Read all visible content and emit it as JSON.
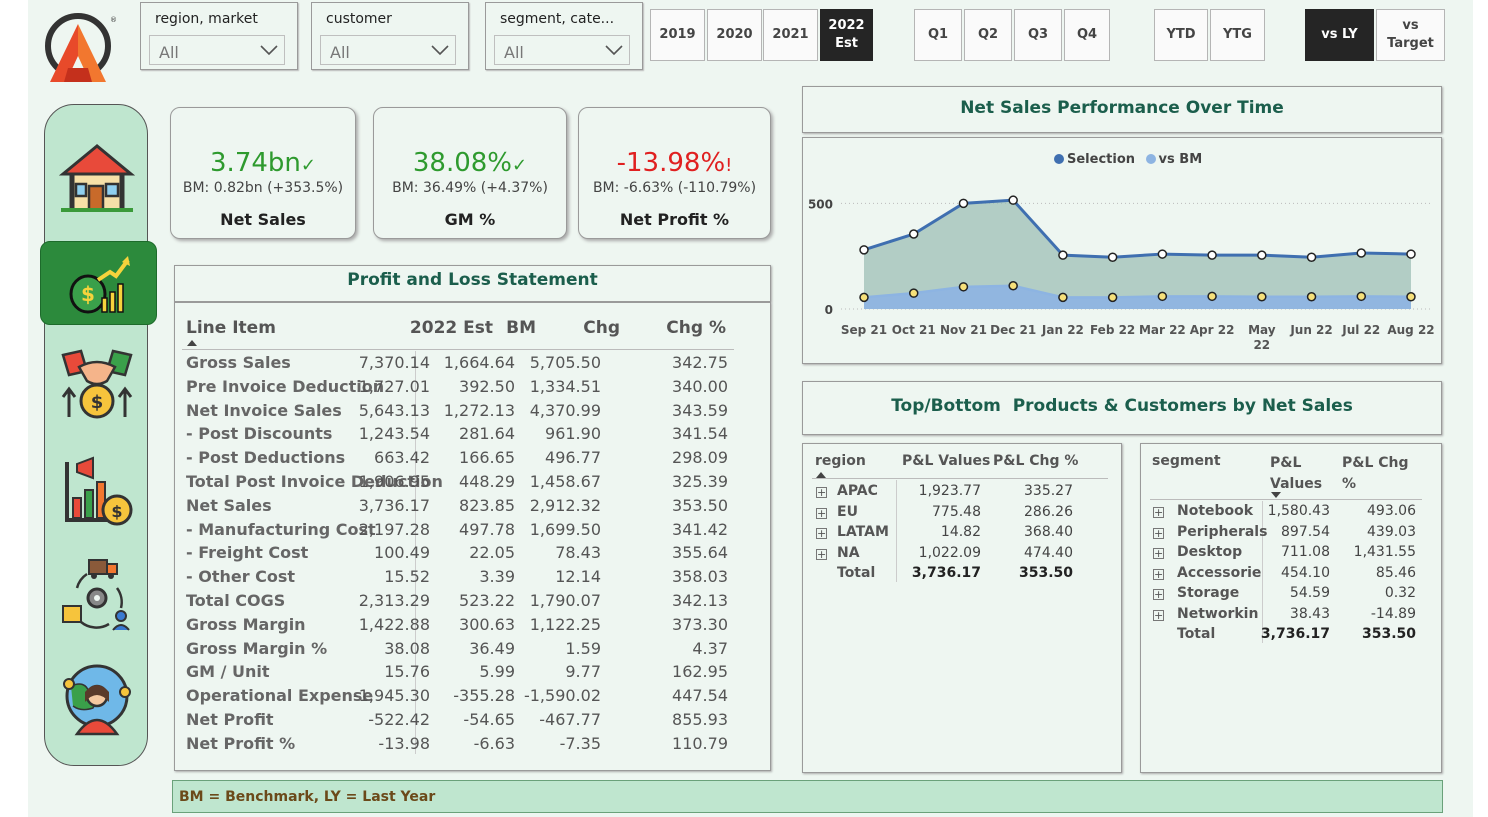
{
  "filters": [
    {
      "label": "region, market",
      "value": "All"
    },
    {
      "label": "customer",
      "value": "All"
    },
    {
      "label": "segment, cate...",
      "value": "All"
    }
  ],
  "years": [
    "2019",
    "2020",
    "2021",
    "2022 Est"
  ],
  "quarters": [
    "Q1",
    "Q2",
    "Q3",
    "Q4"
  ],
  "period": [
    "YTD",
    "YTG"
  ],
  "compare": [
    "vs LY",
    "vs Target"
  ],
  "kpis": [
    {
      "value": "3.74bn",
      "mark": "✓",
      "bm": "BM: 0.82bn (+353.5%)",
      "title": "Net Sales",
      "color": "#2e9a2e"
    },
    {
      "value": "38.08%",
      "mark": "✓",
      "bm": "BM: 36.49% (+4.37%)",
      "title": "GM %",
      "color": "#2e9a2e"
    },
    {
      "value": "-13.98%",
      "mark": "!",
      "bm": "BM: -6.63% (-110.79%)",
      "title": "Net Profit %",
      "color": "#e02020"
    }
  ],
  "pl": {
    "title": "Profit and Loss Statement",
    "headers": [
      "Line Item",
      "2022 Est",
      "BM",
      "Chg",
      "Chg %"
    ],
    "rows": [
      [
        "Gross Sales",
        "7,370.14",
        "1,664.64",
        "5,705.50",
        "342.75"
      ],
      [
        "Pre Invoice Deduction",
        "1,727.01",
        "392.50",
        "1,334.51",
        "340.00"
      ],
      [
        "Net Invoice Sales",
        "5,643.13",
        "1,272.13",
        "4,370.99",
        "343.59"
      ],
      [
        "- Post Discounts",
        "1,243.54",
        "281.64",
        "961.90",
        "341.54"
      ],
      [
        "- Post Deductions",
        "663.42",
        "166.65",
        "496.77",
        "298.09"
      ],
      [
        "Total Post Invoice Deduction",
        "1,906.95",
        "448.29",
        "1,458.67",
        "325.39"
      ],
      [
        "Net Sales",
        "3,736.17",
        "823.85",
        "2,912.32",
        "353.50"
      ],
      [
        "- Manufacturing Cost",
        "2,197.28",
        "497.78",
        "1,699.50",
        "341.42"
      ],
      [
        "- Freight Cost",
        "100.49",
        "22.05",
        "78.43",
        "355.64"
      ],
      [
        "- Other Cost",
        "15.52",
        "3.39",
        "12.14",
        "358.03"
      ],
      [
        "Total COGS",
        "2,313.29",
        "523.22",
        "1,790.07",
        "342.13"
      ],
      [
        "Gross Margin",
        "1,422.88",
        "300.63",
        "1,122.25",
        "373.30"
      ],
      [
        "Gross Margin %",
        "38.08",
        "36.49",
        "1.59",
        "4.37"
      ],
      [
        "GM / Unit",
        "15.76",
        "5.99",
        "9.77",
        "162.95"
      ],
      [
        "Operational Expense",
        "-1,945.30",
        "-355.28",
        "-1,590.02",
        "447.54"
      ],
      [
        "Net Profit",
        "-522.42",
        "-54.65",
        "-467.77",
        "855.93"
      ],
      [
        "Net Profit %",
        "-13.98",
        "-6.63",
        "-7.35",
        "110.79"
      ]
    ]
  },
  "line_chart": {
    "title": "Net Sales Performance Over Time",
    "legend": [
      "Selection",
      "vs BM"
    ]
  },
  "chart_data": {
    "type": "area",
    "categories": [
      "Sep 21",
      "Oct 21",
      "Nov 21",
      "Dec 21",
      "Jan 22",
      "Feb 22",
      "Mar 22",
      "Apr 22",
      "May 22",
      "Jun 22",
      "Jul 22",
      "Aug 22"
    ],
    "series": [
      {
        "name": "Selection",
        "values": [
          280,
          355,
          500,
          515,
          255,
          245,
          260,
          255,
          255,
          245,
          265,
          260
        ],
        "color": "#3f6fb0"
      },
      {
        "name": "vs BM",
        "values": [
          55,
          75,
          105,
          110,
          55,
          55,
          60,
          60,
          58,
          58,
          60,
          58
        ],
        "color": "#8db4e2"
      }
    ],
    "yticks": [
      0,
      500
    ],
    "ylim": [
      0,
      620
    ]
  },
  "topbottom": {
    "title": "Top/Bottom  Products & Customers by Net Sales"
  },
  "region_matrix": {
    "headers": [
      "region",
      "P&L Values",
      "P&L Chg %"
    ],
    "rows": [
      [
        "APAC",
        "1,923.77",
        "335.27"
      ],
      [
        "EU",
        "775.48",
        "286.26"
      ],
      [
        "LATAM",
        "14.82",
        "368.40"
      ],
      [
        "NA",
        "1,022.09",
        "474.40"
      ]
    ],
    "total": [
      "Total",
      "3,736.17",
      "353.50"
    ]
  },
  "segment_matrix": {
    "headers": [
      "segment",
      "P&L",
      "Values",
      "P&L Chg",
      "%"
    ],
    "rows": [
      [
        "Notebook",
        "1,580.43",
        "493.06"
      ],
      [
        "Peripherals",
        "897.54",
        "439.03"
      ],
      [
        "Desktop",
        "711.08",
        "1,431.55"
      ],
      [
        "Accessorie",
        "454.10",
        "85.46"
      ],
      [
        "Storage",
        "54.59",
        "0.32"
      ],
      [
        "Networkin",
        "38.43",
        "-14.89"
      ]
    ],
    "total": [
      "Total",
      "3,736.17",
      "353.50"
    ]
  },
  "footer": "BM = Benchmark, LY = Last Year"
}
